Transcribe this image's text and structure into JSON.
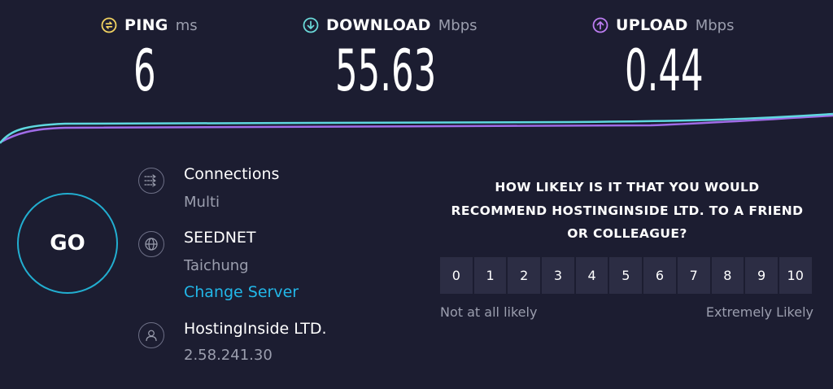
{
  "metrics": {
    "ping": {
      "label": "PING",
      "unit": "ms",
      "value": "6",
      "icon": "ping-icon",
      "color": "#f2d361"
    },
    "download": {
      "label": "DOWNLOAD",
      "unit": "Mbps",
      "value": "55.63",
      "icon": "download-arrow-icon",
      "color": "#6ad9d9"
    },
    "upload": {
      "label": "UPLOAD",
      "unit": "Mbps",
      "value": "0.44",
      "icon": "upload-arrow-icon",
      "color": "#bd7df2"
    }
  },
  "go_label": "GO",
  "connections": {
    "title": "Connections",
    "mode": "Multi",
    "icon": "connections-icon"
  },
  "server": {
    "name": "SEEDNET",
    "location": "Taichung",
    "change_label": "Change Server",
    "icon": "globe-icon"
  },
  "provider": {
    "name": "HostingInside LTD.",
    "ip": "2.58.241.30",
    "icon": "user-icon"
  },
  "survey": {
    "question_lines": [
      "HOW LIKELY IS IT THAT YOU WOULD",
      "RECOMMEND HOSTINGINSIDE LTD. TO A FRIEND",
      "OR COLLEAGUE?"
    ],
    "scale": [
      "0",
      "1",
      "2",
      "3",
      "4",
      "5",
      "6",
      "7",
      "8",
      "9",
      "10"
    ],
    "low_label": "Not at all likely",
    "high_label": "Extremely Likely"
  },
  "colors": {
    "background": "#1c1d31",
    "accent_go": "#22aed0",
    "link": "#22b7e8",
    "scale_button": "#2c2d44"
  }
}
